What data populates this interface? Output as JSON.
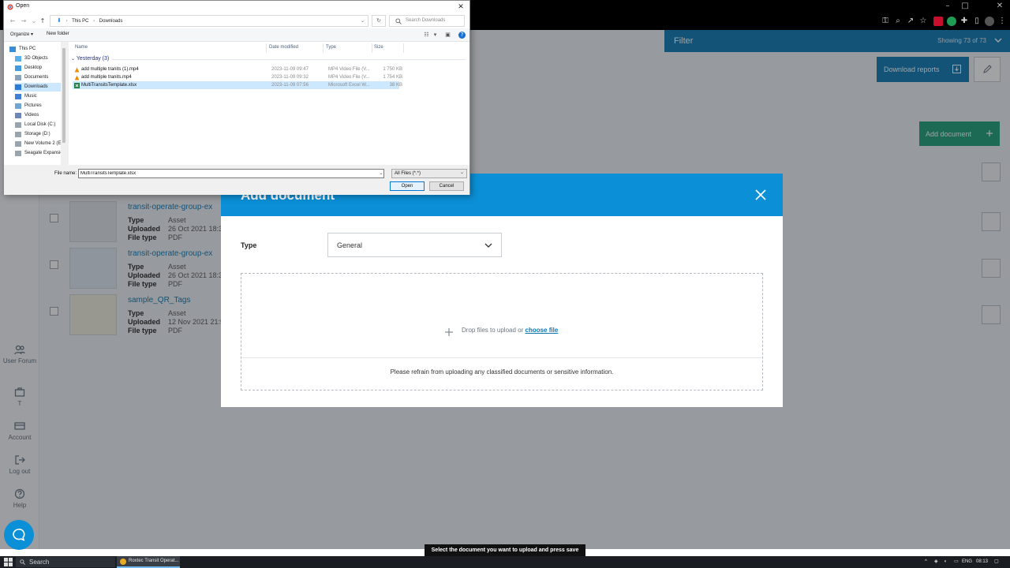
{
  "app": {
    "filter": {
      "label": "Filter",
      "count": "Showing 73 of 73"
    },
    "download_reports_label": "Download reports",
    "add_document_label": "Add document",
    "sidebar": [
      {
        "label": "User Forum",
        "icon": "users-icon"
      },
      {
        "label": "T",
        "icon": "briefcase-icon"
      },
      {
        "label": "Account",
        "icon": "card-icon"
      },
      {
        "label": "Log out",
        "icon": "logout-icon"
      },
      {
        "label": "Help",
        "icon": "help-icon"
      }
    ],
    "documents": [
      {
        "title": "transit-operate-group-ex",
        "type_key": "Type",
        "type": "Asset",
        "uploaded_key": "Uploaded",
        "uploaded": "26 Oct 2021 18:3",
        "filetype_key": "File type",
        "filetype": "PDF"
      },
      {
        "title": "transit-operate-group-ex",
        "type_key": "Type",
        "type": "Asset",
        "uploaded_key": "Uploaded",
        "uploaded": "26 Oct 2021 18:3",
        "filetype_key": "File type",
        "filetype": "PDF"
      },
      {
        "title": "sample_QR_Tags",
        "type_key": "Type",
        "type": "Asset",
        "uploaded_key": "Uploaded",
        "uploaded": "12 Nov 2021 21:5",
        "filetype_key": "File type",
        "filetype": "PDF"
      }
    ],
    "accent_color": "#0b77b4",
    "add_color": "#1a9f74"
  },
  "modal": {
    "title": "Add document",
    "type_label": "Type",
    "type_value": "General",
    "dropzone_text": "Drop files to upload or",
    "dropzone_link": "choose file",
    "warning": "Please refrain from uploading any classified documents or sensitive information."
  },
  "dialog": {
    "title": "Open",
    "address": [
      "This PC",
      "Downloads"
    ],
    "search_placeholder": "Search Downloads",
    "organize_label": "Organize",
    "new_folder_label": "New folder",
    "nav": [
      {
        "label": "This PC",
        "icon": "pc-icon"
      },
      {
        "label": "3D Objects",
        "icon": "cube-icon"
      },
      {
        "label": "Desktop",
        "icon": "folder-icon"
      },
      {
        "label": "Documents",
        "icon": "folder-icon"
      },
      {
        "label": "Downloads",
        "icon": "download-icon"
      },
      {
        "label": "Music",
        "icon": "music-icon"
      },
      {
        "label": "Pictures",
        "icon": "folder-icon"
      },
      {
        "label": "Videos",
        "icon": "folder-icon"
      },
      {
        "label": "Local Disk (C:)",
        "icon": "drive-icon"
      },
      {
        "label": "Storage (D:)",
        "icon": "drive-icon"
      },
      {
        "label": "New Volume 2 (E",
        "icon": "drive-icon"
      },
      {
        "label": "Seagate Expansio",
        "icon": "drive-icon"
      }
    ],
    "columns": {
      "name": "Name",
      "date": "Date modified",
      "type": "Type",
      "size": "Size"
    },
    "group": "Yesterday (3)",
    "files": [
      {
        "name": "add multiple tranits (1).mp4",
        "date": "2023-11-09 09:47",
        "type": "MP4 Video File (V...",
        "size": "1 750 KB",
        "icon": "vlc-icon"
      },
      {
        "name": "add multiple tranits.mp4",
        "date": "2023-11-09 09:32",
        "type": "MP4 Video File (V...",
        "size": "1 754 KB",
        "icon": "vlc-icon"
      },
      {
        "name": "MultiTransitsTemplate.xlsx",
        "date": "2023-11-09 07:56",
        "type": "Microsoft Excel W...",
        "size": "38 KB",
        "icon": "excel-icon"
      }
    ],
    "filename_label": "File name:",
    "filename_value": "MultiTransitsTemplate.xlsx",
    "filter_value": "All Files (*.*)",
    "open_label": "Open",
    "cancel_label": "Cancel"
  },
  "hint": "Select the document you want to upload and press save",
  "taskbar": {
    "search_label": "Search",
    "app_label": "Roxtec Transit Operat...",
    "language": "ENG",
    "time": "08:13"
  }
}
